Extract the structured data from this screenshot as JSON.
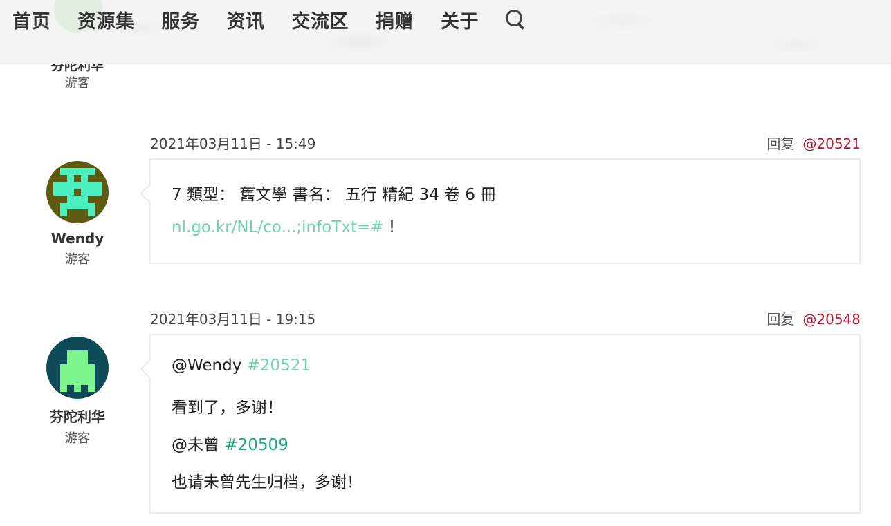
{
  "nav": {
    "items": [
      "首页",
      "资源集",
      "服务",
      "资讯",
      "交流区",
      "捐赠",
      "关于"
    ]
  },
  "prev_author": {
    "name": "芬陀利华",
    "role": "游客"
  },
  "comments": [
    {
      "date": "2021年03月11日 - 15:49",
      "reply_label": "回复",
      "ref": "@20521",
      "author": {
        "name": "Wendy",
        "role": "游客"
      },
      "line1": "7 類型：  舊文學 書名：  五行 精紀 34 卷 6 冊",
      "link": "nl.go.kr/NL/co...;infoTxt=#",
      "link_suffix": " !"
    },
    {
      "date": "2021年03月11日 - 19:15",
      "reply_label": "回复",
      "ref": "@20548",
      "author": {
        "name": "芬陀利华",
        "role": "游客"
      },
      "mention1": "@Wendy ",
      "mention1_ref": "#20521",
      "text1": "看到了，多谢！",
      "mention2": "@未曾 ",
      "mention2_ref": "#20509",
      "text2": "也请未曾先生归档，多谢！"
    }
  ],
  "colors": {
    "accent_red": "#c0112b",
    "link_light": "#6fd3a9",
    "link_dark": "#1aab7c"
  },
  "icons": [
    "search-icon"
  ]
}
